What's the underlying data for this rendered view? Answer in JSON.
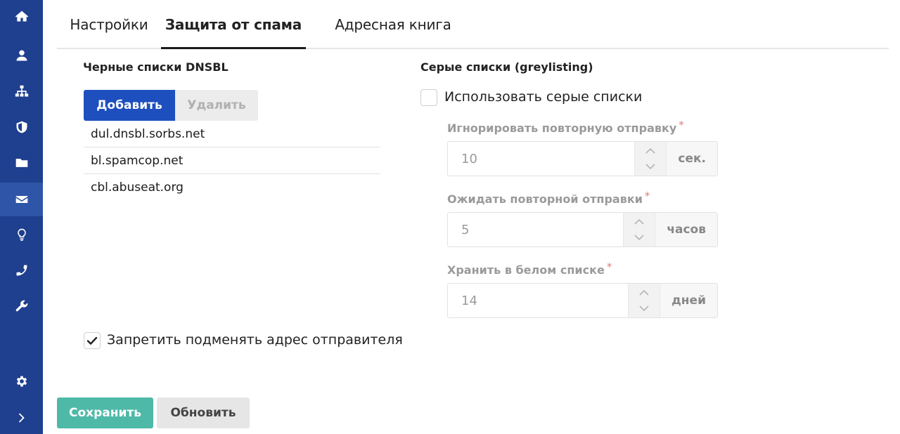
{
  "sidebar": {
    "items": [
      {
        "icon": "home-icon"
      },
      {
        "icon": "user-icon"
      },
      {
        "icon": "sitemap-icon"
      },
      {
        "icon": "shield-icon"
      },
      {
        "icon": "folder-icon"
      },
      {
        "icon": "envelope-icon",
        "active": true
      },
      {
        "icon": "lightbulb-icon"
      },
      {
        "icon": "phone-icon"
      },
      {
        "icon": "wrench-icon"
      },
      {
        "icon": "gear-icon"
      },
      {
        "icon": "chevron-right-icon"
      }
    ]
  },
  "tabs": [
    {
      "label": "Настройки",
      "active": false
    },
    {
      "label": "Защита от спама",
      "active": true
    },
    {
      "label": "Адресная книга",
      "active": false
    }
  ],
  "dnsbl": {
    "title": "Черные списки DNSBL",
    "add_label": "Добавить",
    "delete_label": "Удалить",
    "entries": [
      "dul.dnsbl.sorbs.net",
      "bl.spamcop.net",
      "cbl.abuseat.org"
    ]
  },
  "sender_check": {
    "label": "Запретить подменять адрес отправителя",
    "checked": true
  },
  "greylisting": {
    "title": "Серые списки (greylisting)",
    "enable_label": "Использовать серые списки",
    "enabled": false,
    "fields": [
      {
        "label": "Игнорировать повторную отправку",
        "required": "*",
        "value": "10",
        "unit": "сек."
      },
      {
        "label": "Ожидать повторной отправки",
        "required": "*",
        "value": "5",
        "unit": "часов"
      },
      {
        "label": "Хранить в белом списке",
        "required": "*",
        "value": "14",
        "unit": "дней"
      }
    ]
  },
  "footer": {
    "save_label": "Сохранить",
    "refresh_label": "Обновить"
  },
  "colors": {
    "sidebar": "#1f3f8f",
    "sidebar_active": "#2f55a8",
    "primary": "#1e4fbf",
    "save": "#4fb9a8"
  }
}
